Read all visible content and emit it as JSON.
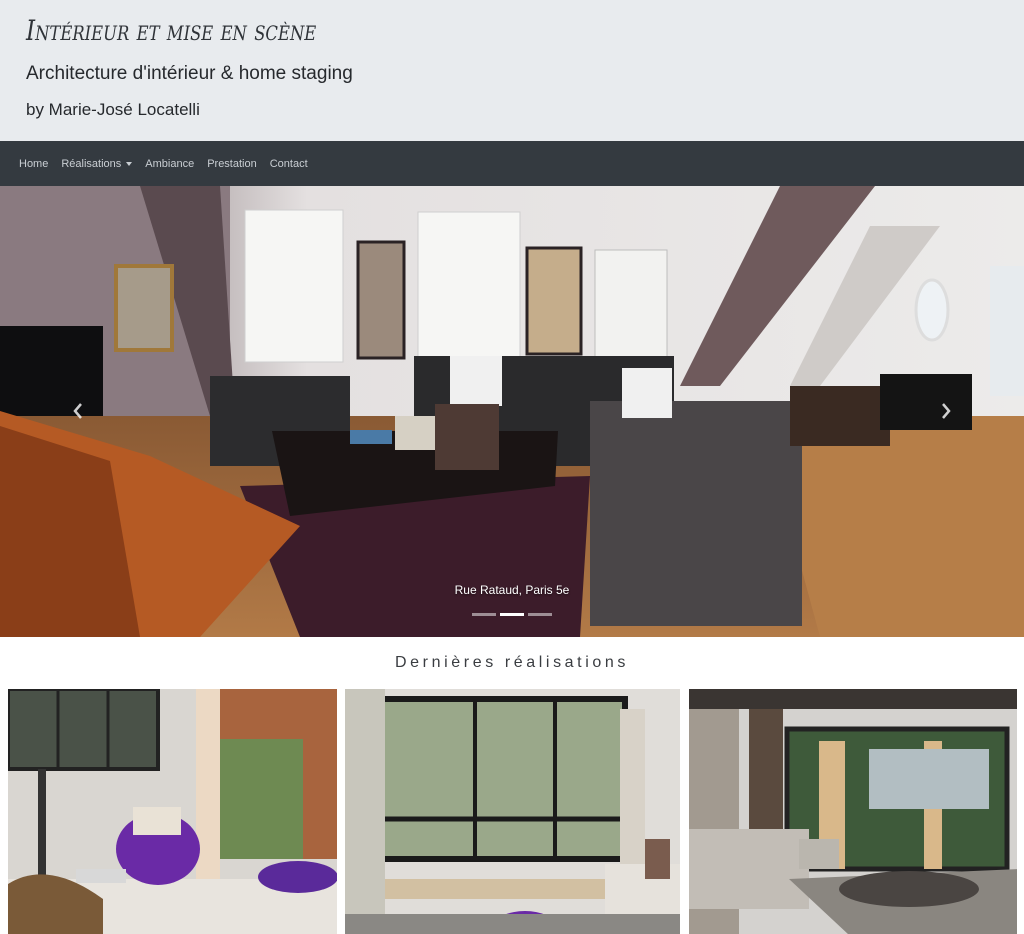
{
  "header": {
    "brand": "Intérieur et mise en scène",
    "tagline": "Architecture d'intérieur & home staging",
    "author": "by Marie-José Locatelli"
  },
  "nav": {
    "items": [
      "Home",
      "Réalisations",
      "Ambiance",
      "Prestation",
      "Contact"
    ]
  },
  "carousel": {
    "caption": "Rue Rataud, Paris 5e",
    "slide_count": 3,
    "active_index": 1
  },
  "section": {
    "title": "Dernières réalisations"
  },
  "colors": {
    "header_bg": "#e8ebee",
    "navbar_bg": "#343a40",
    "nav_text": "#c9ced3",
    "text_dark": "#26292d"
  }
}
